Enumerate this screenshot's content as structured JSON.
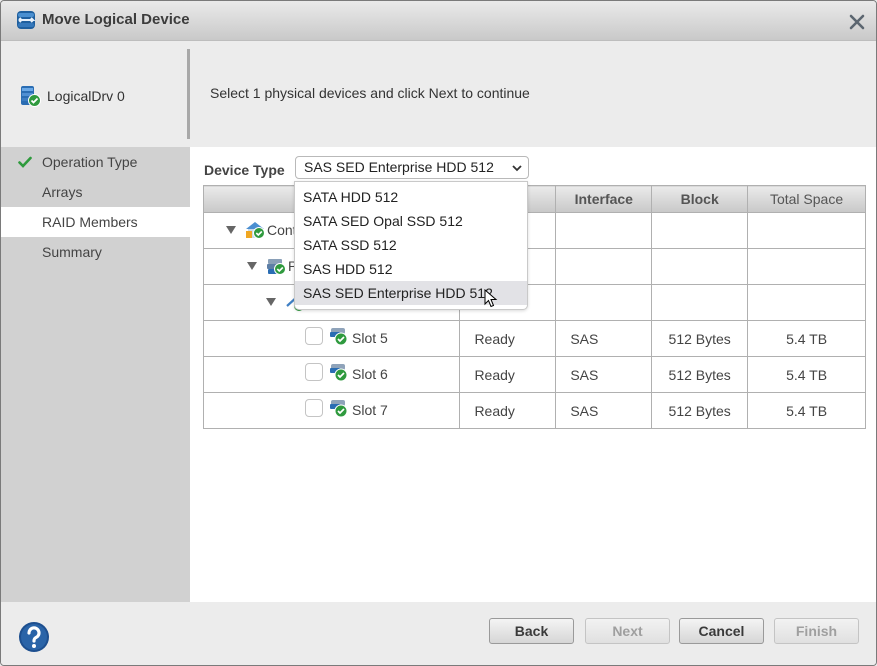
{
  "dialog": {
    "title": "Move Logical Device",
    "icon": "move-logical-device-icon",
    "close_icon": "close-icon"
  },
  "header": {
    "device_name": "LogicalDrv 0",
    "device_icon": "logical-drive-ok-icon",
    "instruction": "Select 1 physical devices and click Next to continue"
  },
  "steps": [
    {
      "label": "Operation Type",
      "completed": true,
      "active": false
    },
    {
      "label": "Arrays",
      "completed": false,
      "active": false
    },
    {
      "label": "RAID Members",
      "completed": false,
      "active": true
    },
    {
      "label": "Summary",
      "completed": false,
      "active": false
    }
  ],
  "device_type": {
    "label": "Device Type",
    "selected": "SAS SED Enterprise HDD 512",
    "options": [
      "SATA HDD 512",
      "SATA SED Opal SSD 512",
      "SATA SSD 512",
      "SAS HDD 512",
      "SAS SED Enterprise HDD 512"
    ],
    "highlighted_index": 4
  },
  "table": {
    "columns": [
      "",
      "",
      "Interface",
      "Block",
      "Total Space"
    ],
    "tree_rows": [
      {
        "label": "Controller",
        "visible_label": "Cont",
        "icon": "controller-icon",
        "level": 0
      },
      {
        "label": "P",
        "visible_label": "P",
        "icon": "physical-devices-icon",
        "level": 1
      },
      {
        "label": "",
        "visible_label": "",
        "icon": "enclosure-icon",
        "level": 2
      }
    ],
    "device_rows": [
      {
        "slot": "Slot 5",
        "status": "Ready",
        "interface": "SAS",
        "block": "512 Bytes",
        "total_space": "5.4 TB",
        "checked": false
      },
      {
        "slot": "Slot 6",
        "status": "Ready",
        "interface": "SAS",
        "block": "512 Bytes",
        "total_space": "5.4 TB",
        "checked": false
      },
      {
        "slot": "Slot 7",
        "status": "Ready",
        "interface": "SAS",
        "block": "512 Bytes",
        "total_space": "5.4 TB",
        "checked": false
      }
    ]
  },
  "footer": {
    "help_icon": "help-icon",
    "back": "Back",
    "next": "Next",
    "cancel": "Cancel",
    "finish": "Finish"
  }
}
